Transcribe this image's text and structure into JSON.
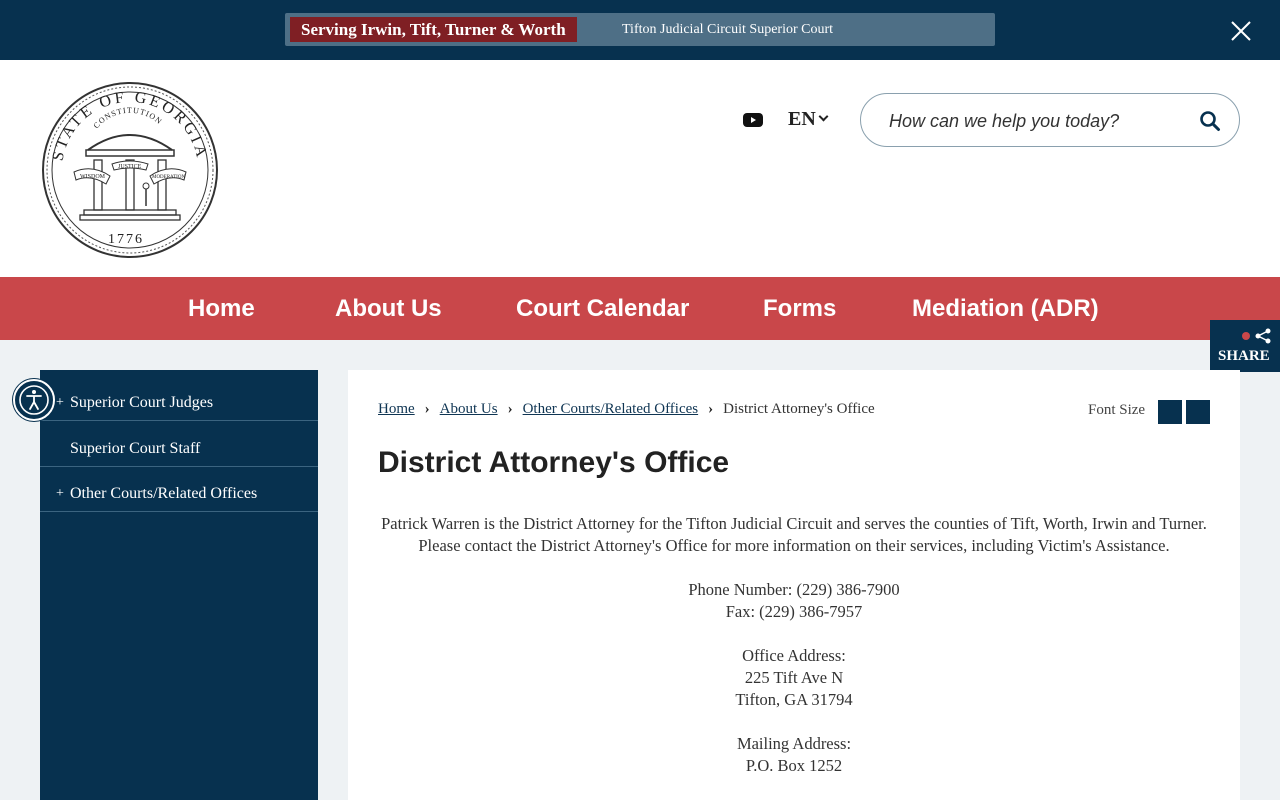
{
  "alert": {
    "tag": "Serving Irwin, Tift, Turner & Worth",
    "text": "Tifton Judicial Circuit Superior Court"
  },
  "header": {
    "seal": {
      "top_text": "STATE OF GEORGIA",
      "inner_text": "CONSTITUTION",
      "banners": [
        "WISDOM",
        "JUSTICE",
        "MODERATION"
      ],
      "year": "1776"
    },
    "language": "EN",
    "search_placeholder": "How can we help you today?"
  },
  "nav": {
    "items": [
      "Home",
      "About Us",
      "Court Calendar",
      "Forms",
      "Mediation (ADR)"
    ]
  },
  "share_label": "SHARE",
  "sidebar": {
    "items": [
      {
        "label": "Superior Court Judges",
        "prefix": "+"
      },
      {
        "label": "Superior Court Staff",
        "prefix": ""
      },
      {
        "label": "Other Courts/Related Offices",
        "prefix": "+"
      }
    ]
  },
  "breadcrumb": {
    "links": [
      "Home",
      "About Us",
      "Other Courts/Related Offices"
    ],
    "current": "District Attorney's Office"
  },
  "font_size_label": "Font Size",
  "page_title": "District Attorney's Office",
  "body": {
    "intro": "Patrick Warren is the District Attorney for the Tifton Judicial Circuit and serves the counties of Tift, Worth, Irwin and Turner. Please contact the District Attorney's Office for more information on their services, including Victim's Assistance.",
    "phone": "Phone Number: (229) 386-7900",
    "fax": "Fax: (229) 386-7957",
    "office_heading": "Office Address:",
    "office_line1": "225 Tift Ave N",
    "office_line2": "Tifton, GA 31794",
    "mailing_heading": "Mailing Address:",
    "mailing_line1": "P.O. Box 1252"
  },
  "colors": {
    "navy": "#07314f",
    "nav_red": "#c9474a",
    "alert_tag": "#7f1f24"
  }
}
